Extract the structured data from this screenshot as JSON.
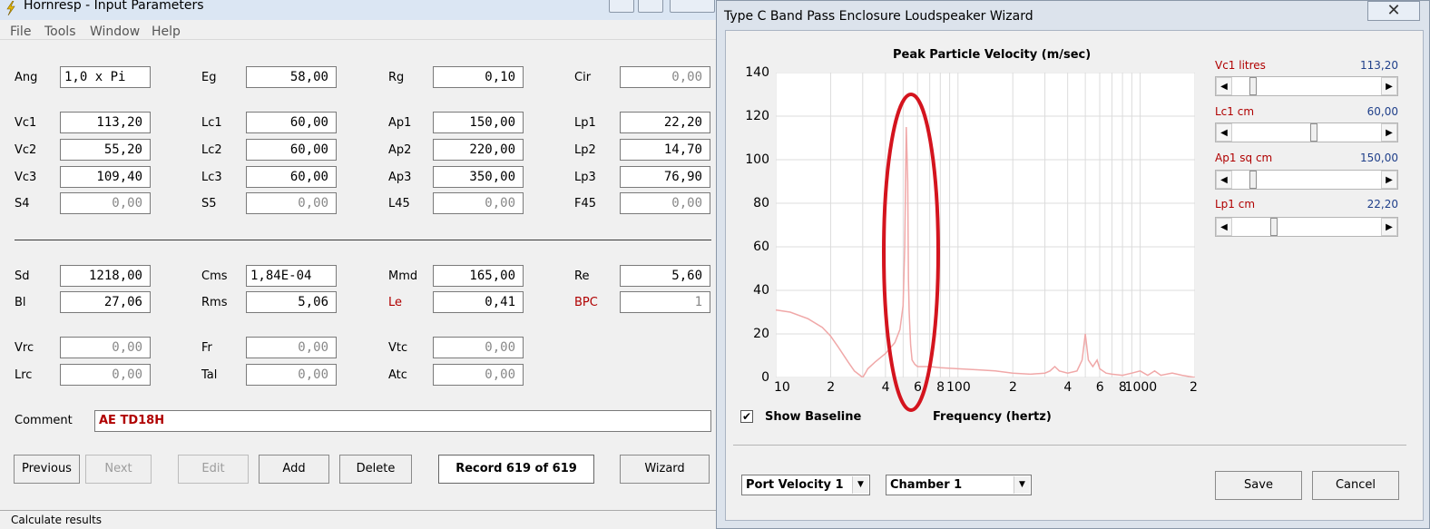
{
  "main_window": {
    "title": "Hornresp - Input Parameters",
    "menu": [
      "File",
      "Tools",
      "Window",
      "Help"
    ],
    "rows": [
      {
        "label": "Ang",
        "value": "1,0 x Pi",
        "label2": "Eg",
        "value2": "58,00",
        "label3": "Rg",
        "value3": "0,10",
        "label4": "Cir",
        "value4": "0,00"
      },
      {
        "label": "Vc1",
        "value": "113,20",
        "label2": "Lc1",
        "value2": "60,00",
        "label3": "Ap1",
        "value3": "150,00",
        "label4": "Lp1",
        "value4": "22,20"
      },
      {
        "label": "Vc2",
        "value": "55,20",
        "label2": "Lc2",
        "value2": "60,00",
        "label3": "Ap2",
        "value3": "220,00",
        "label4": "Lp2",
        "value4": "14,70"
      },
      {
        "label": "Vc3",
        "value": "109,40",
        "label2": "Lc3",
        "value2": "60,00",
        "label3": "Ap3",
        "value3": "350,00",
        "label4": "Lp3",
        "value4": "76,90"
      },
      {
        "label": "S4",
        "value": "0,00",
        "label2": "S5",
        "value2": "0,00",
        "label3": "L45",
        "value3": "0,00",
        "label4": "F45",
        "value4": "0,00"
      },
      {
        "label": "Sd",
        "value": "1218,00",
        "label2": "Cms",
        "value2": "1,84E-04",
        "label3": "Mmd",
        "value3": "165,00",
        "label4": "Re",
        "value4": "5,60"
      },
      {
        "label": "Bl",
        "value": "27,06",
        "label2": "Rms",
        "value2": "5,06",
        "label3": "Le",
        "value3": "0,41",
        "label4": "BPC",
        "value4": "1"
      },
      {
        "label": "Vrc",
        "value": "0,00",
        "label2": "Fr",
        "value2": "0,00",
        "label3": "Vtc",
        "value3": "0,00"
      },
      {
        "label": "Lrc",
        "value": "0,00",
        "label2": "Tal",
        "value2": "0,00",
        "label3": "Atc",
        "value3": "0,00"
      }
    ],
    "comment_label": "Comment",
    "comment_value": "AE TD18H",
    "buttons": {
      "previous": "Previous",
      "next": "Next",
      "edit": "Edit",
      "add": "Add",
      "delete": "Delete",
      "wizard": "Wizard"
    },
    "record": "Record 619 of 619",
    "status": "Calculate results"
  },
  "wizard": {
    "title": "Type C Band Pass Enclosure Loudspeaker Wizard",
    "close": "✕",
    "sliders": [
      {
        "label": "Vc1  litres",
        "value": "113,20",
        "position": 0.12
      },
      {
        "label": "Lc1  cm",
        "value": "60,00",
        "position": 0.55
      },
      {
        "label": "Ap1  sq cm",
        "value": "150,00",
        "position": 0.12
      },
      {
        "label": "Lp1  cm",
        "value": "22,20",
        "position": 0.27
      }
    ],
    "show_baseline": "Show Baseline",
    "show_baseline_checked": true,
    "combo1": "Port Velocity 1",
    "combo2": "Chamber 1",
    "save": "Save",
    "cancel": "Cancel"
  },
  "chart_data": {
    "type": "line",
    "title": "Peak Particle Velocity (m/sec)",
    "xlabel": "Frequency (hertz)",
    "ylabel": "",
    "x_scale": "log",
    "xlim": [
      10,
      2000
    ],
    "ylim": [
      0,
      140
    ],
    "yticks": [
      "0",
      "20",
      "40",
      "60",
      "80",
      "100",
      "120",
      "140"
    ],
    "xticks": [
      "10",
      "2",
      "4",
      "6",
      "8",
      "100",
      "2",
      "4",
      "6",
      "8",
      "1000",
      "2"
    ],
    "grid": true,
    "series": [
      {
        "x": [
          10,
          12,
          15,
          18,
          20,
          22,
          25,
          27,
          29,
          30,
          31,
          32,
          35,
          40,
          45,
          48,
          50,
          51,
          52,
          53,
          53.5,
          54,
          55,
          56,
          58,
          60,
          70,
          80,
          100,
          130,
          160,
          200,
          250,
          300,
          320,
          340,
          360,
          400,
          450,
          480,
          500,
          520,
          550,
          580,
          600,
          650,
          700,
          800,
          900,
          1000,
          1100,
          1200,
          1300,
          1500,
          1700,
          2000
        ],
        "y": [
          31,
          30,
          27,
          23,
          19,
          14,
          7,
          3,
          1,
          0,
          2,
          4,
          7,
          11,
          16,
          22,
          33,
          60,
          115,
          90,
          45,
          30,
          15,
          8,
          6,
          5,
          5,
          4.5,
          4,
          3.5,
          3,
          2,
          1.5,
          2,
          3,
          5,
          3,
          2,
          3,
          8,
          20,
          8,
          5,
          8,
          4,
          2,
          1.5,
          1,
          2,
          3,
          1,
          3,
          1,
          2,
          1,
          0
        ]
      }
    ],
    "annotation": "red ellipse highlighting peak near 50 Hz"
  }
}
